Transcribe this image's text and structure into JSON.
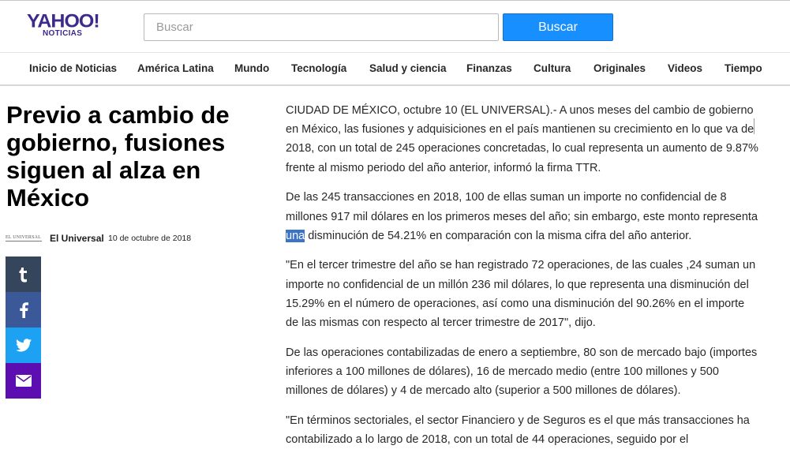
{
  "header": {
    "logo_main": "YAHOO!",
    "logo_sub": "NOTICIAS",
    "search_placeholder": "Buscar",
    "search_button": "Buscar",
    "accent_color": "#188fff",
    "brand_color": "#3e2a8a"
  },
  "nav": {
    "items": [
      "Inicio de Noticias",
      "América Latina",
      "Mundo",
      "Tecnología",
      "Salud y ciencia",
      "Finanzas",
      "Cultura",
      "Originales",
      "Videos",
      "Tiempo"
    ]
  },
  "article": {
    "title": "Previo a cambio de gobierno, fusiones siguen al alza en México",
    "source_logo_text": "EL UNIVERSAL",
    "source": "El Universal",
    "date": "10 de octubre de 2018",
    "p1": "CIUDAD DE MÉXICO, octubre 10 (EL UNIVERSAL).- A unos meses del cambio de gobierno en México, las fusiones y adquisiciones en el país mantienen su crecimiento en lo que va de 2018, con un total de 245 operaciones concretadas, lo cual representa un aumento de 9.87% frente al mismo periodo del año anterior, informó la firma TTR.",
    "p2_before": "De las 245 transacciones en 2018, 100 de ellas suman un importe no confidencial de 8 millones 917 mil dólares en los primeros meses del año; sin embargo, este monto representa ",
    "p2_highlight": "una",
    "p2_after": " disminución de 54.21% en comparación con la misma cifra del año anterior.",
    "p3": "\"En el tercer trimestre del año se han registrado 72 operaciones, de las cuales ,24 suman un importe no confidencial de un millón 236 mil dólares, lo que representa una disminución del 15.29% en el número de operaciones, así como una disminución del 90.26% en el importe de las mismas con respecto al tercer trimestre de 2017\", dijo.",
    "p4": "De las operaciones contabilizadas de enero a septiembre, 80 son de mercado bajo (importes inferiores a 100 millones de dólares), 16 de mercado medio (entre 100 millones y 500 millones de dólares) y 4 de mercado alto (superior a 500 millones de dólares).",
    "p5": "\"En términos sectoriales, el sector Financiero y de Seguros es el que más transacciones ha contabilizado a lo largo de 2018, con un total de 44 operaciones, seguido por el"
  },
  "share": {
    "icons": [
      "tumblr-icon",
      "facebook-icon",
      "twitter-icon",
      "mail-icon"
    ],
    "colors": [
      "#35465c",
      "#3b5998",
      "#1da1f2",
      "#5c0eb0"
    ]
  }
}
